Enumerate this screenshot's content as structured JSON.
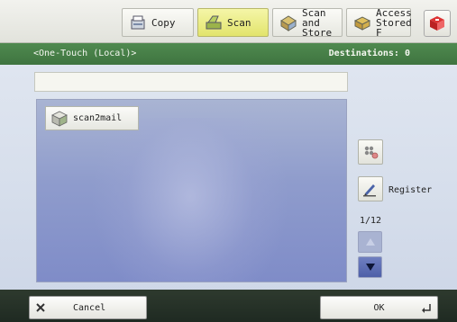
{
  "tabs": [
    {
      "label": "Copy",
      "icon": "copy-icon",
      "active": false
    },
    {
      "label": "Scan",
      "icon": "scan-icon",
      "active": true
    },
    {
      "label_lines": [
        "Scan and",
        "Store"
      ],
      "icon": "scan-and-store-icon",
      "active": false
    },
    {
      "label_lines": [
        "Access",
        "Stored F"
      ],
      "icon": "access-stored-files-icon",
      "active": false
    }
  ],
  "header": {
    "title": "<One-Touch (Local)>",
    "destinations_label": "Destinations:",
    "destinations_count": "0"
  },
  "address": {
    "value": ""
  },
  "list": {
    "items": [
      {
        "label": "scan2mail",
        "icon": "destination-icon"
      }
    ]
  },
  "side": {
    "register_label": "Register",
    "page_indicator": "1/12"
  },
  "footer": {
    "cancel_label": "Cancel",
    "ok_label": "OK"
  },
  "colors": {
    "header_green": "#4a824a",
    "active_tab_yellow": "#e6e87a",
    "list_blue": "#8f9ccc",
    "bottom_bar": "#25302a"
  }
}
